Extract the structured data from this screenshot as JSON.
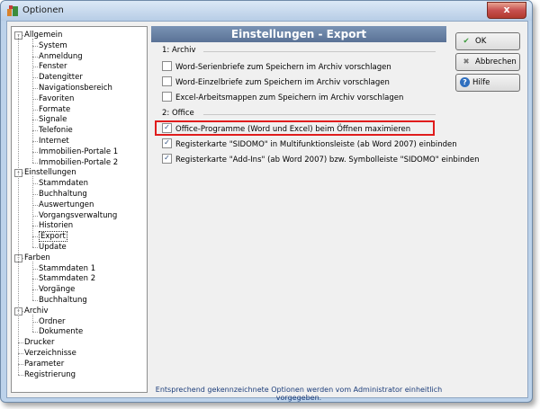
{
  "window": {
    "title": "Optionen",
    "close": "x"
  },
  "tree": [
    {
      "label": "Allgemein",
      "level": 0,
      "expander": "-"
    },
    {
      "label": "System",
      "level": 1
    },
    {
      "label": "Anmeldung",
      "level": 1
    },
    {
      "label": "Fenster",
      "level": 1
    },
    {
      "label": "Datengitter",
      "level": 1
    },
    {
      "label": "Navigationsbereich",
      "level": 1
    },
    {
      "label": "Favoriten",
      "level": 1
    },
    {
      "label": "Formate",
      "level": 1
    },
    {
      "label": "Signale",
      "level": 1
    },
    {
      "label": "Telefonie",
      "level": 1
    },
    {
      "label": "Internet",
      "level": 1
    },
    {
      "label": "Immobilien-Portale 1",
      "level": 1
    },
    {
      "label": "Immobilien-Portale 2",
      "level": 1
    },
    {
      "label": "Einstellungen",
      "level": 0,
      "expander": "-"
    },
    {
      "label": "Stammdaten",
      "level": 1
    },
    {
      "label": "Buchhaltung",
      "level": 1
    },
    {
      "label": "Auswertungen",
      "level": 1
    },
    {
      "label": "Vorgangsverwaltung",
      "level": 1
    },
    {
      "label": "Historien",
      "level": 1
    },
    {
      "label": "Export",
      "level": 1,
      "selected": true
    },
    {
      "label": "Update",
      "level": 1
    },
    {
      "label": "Farben",
      "level": 0,
      "expander": "-"
    },
    {
      "label": "Stammdaten 1",
      "level": 1
    },
    {
      "label": "Stammdaten 2",
      "level": 1
    },
    {
      "label": "Vorgänge",
      "level": 1
    },
    {
      "label": "Buchhaltung",
      "level": 1
    },
    {
      "label": "Archiv",
      "level": 0,
      "expander": "-"
    },
    {
      "label": "Ordner",
      "level": 1
    },
    {
      "label": "Dokumente",
      "level": 1
    },
    {
      "label": "Drucker",
      "level": 0
    },
    {
      "label": "Verzeichnisse",
      "level": 0
    },
    {
      "label": "Parameter",
      "level": 0
    },
    {
      "label": "Registrierung",
      "level": 0
    }
  ],
  "panel": {
    "title": "Einstellungen - Export",
    "archiv": {
      "label": "1: Archiv",
      "options": [
        {
          "label": "Word-Serienbriefe zum Speichern im Archiv vorschlagen",
          "checked": false
        },
        {
          "label": "Word-Einzelbriefe zum Speichern im Archiv vorschlagen",
          "checked": false
        },
        {
          "label": "Excel-Arbeitsmappen zum Speichern im Archiv vorschlagen",
          "checked": false
        }
      ]
    },
    "office": {
      "label": "2: Office",
      "options": [
        {
          "label": "Office-Programme (Word und Excel) beim Öffnen maximieren",
          "checked": true
        },
        {
          "label": "Registerkarte \"SIDOMO\" in Multifunktionsleiste (ab Word 2007) einbinden",
          "checked": true
        },
        {
          "label": "Registerkarte \"Add-Ins\" (ab Word 2007) bzw. Symbolleiste \"SIDOMO\" einbinden",
          "checked": true
        }
      ]
    },
    "footer": "Entsprechend gekennzeichnete Optionen werden vom Administrator einheitlich vorgegeben."
  },
  "buttons": {
    "ok": "OK",
    "cancel": "Abbrechen",
    "help": "Hilfe"
  },
  "colors": {
    "accent": "#5a7296",
    "highlight": "#e01c1c",
    "check": "#2a4b7c"
  }
}
